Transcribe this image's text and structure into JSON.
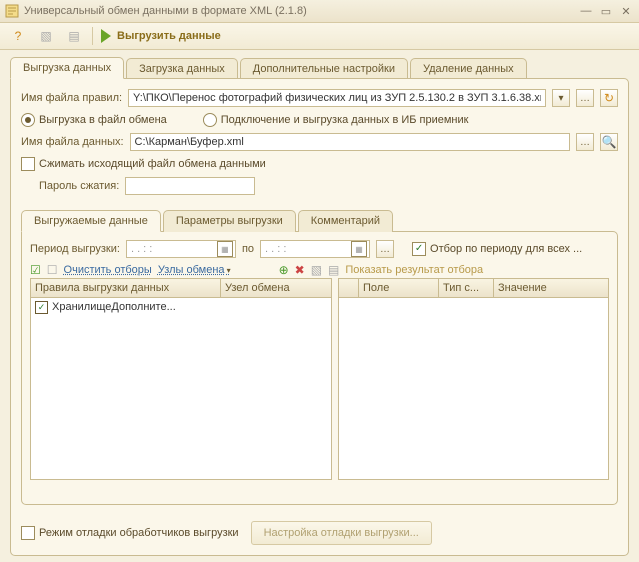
{
  "window": {
    "title": "Универсальный обмен данными в формате XML (2.1.8)"
  },
  "toolbar": {
    "launch_label": "Выгрузить данные"
  },
  "main_tabs": [
    {
      "label": "Выгрузка данных",
      "active": true
    },
    {
      "label": "Загрузка данных"
    },
    {
      "label": "Дополнительные настройки"
    },
    {
      "label": "Удаление данных"
    }
  ],
  "fields": {
    "rules_label": "Имя файла правил:",
    "rules_value": "Y:\\ПКО\\Перенос фотографий физических лиц из ЗУП 2.5.130.2 в ЗУП 3.1.6.38.xml",
    "radio_file": "Выгрузка в файл обмена",
    "radio_ib": "Подключение и выгрузка данных в ИБ приемник",
    "datafile_label": "Имя файла данных:",
    "datafile_value": "C:\\Карман\\Буфер.xml",
    "compress_label": "Сжимать исходящий файл обмена данными",
    "password_label": "Пароль сжатия:"
  },
  "sub_tabs": [
    {
      "label": "Выгружаемые данные",
      "active": true
    },
    {
      "label": "Параметры выгрузки"
    },
    {
      "label": "Комментарий"
    }
  ],
  "period": {
    "label": "Период выгрузки:",
    "from_placeholder": ". .   : :",
    "to_label": "по",
    "to_placeholder": ". .   : :",
    "filter_checkbox": "Отбор по периоду для всех ..."
  },
  "grid_toolbar": {
    "clear_filters": "Очистить отборы",
    "nodes": "Узлы обмена",
    "show_result": "Показать результат отбора"
  },
  "left_grid": {
    "col1": "Правила выгрузки данных",
    "col2": "Узел обмена",
    "rows": [
      {
        "checked": true,
        "rule": "ХранилищеДополните...",
        "node": ""
      }
    ]
  },
  "right_grid": {
    "col1": "Поле",
    "col2": "Тип с...",
    "col3": "Значение"
  },
  "footer": {
    "debug_checkbox": "Режим отладки обработчиков выгрузки",
    "debug_btn": "Настройка отладки выгрузки..."
  }
}
